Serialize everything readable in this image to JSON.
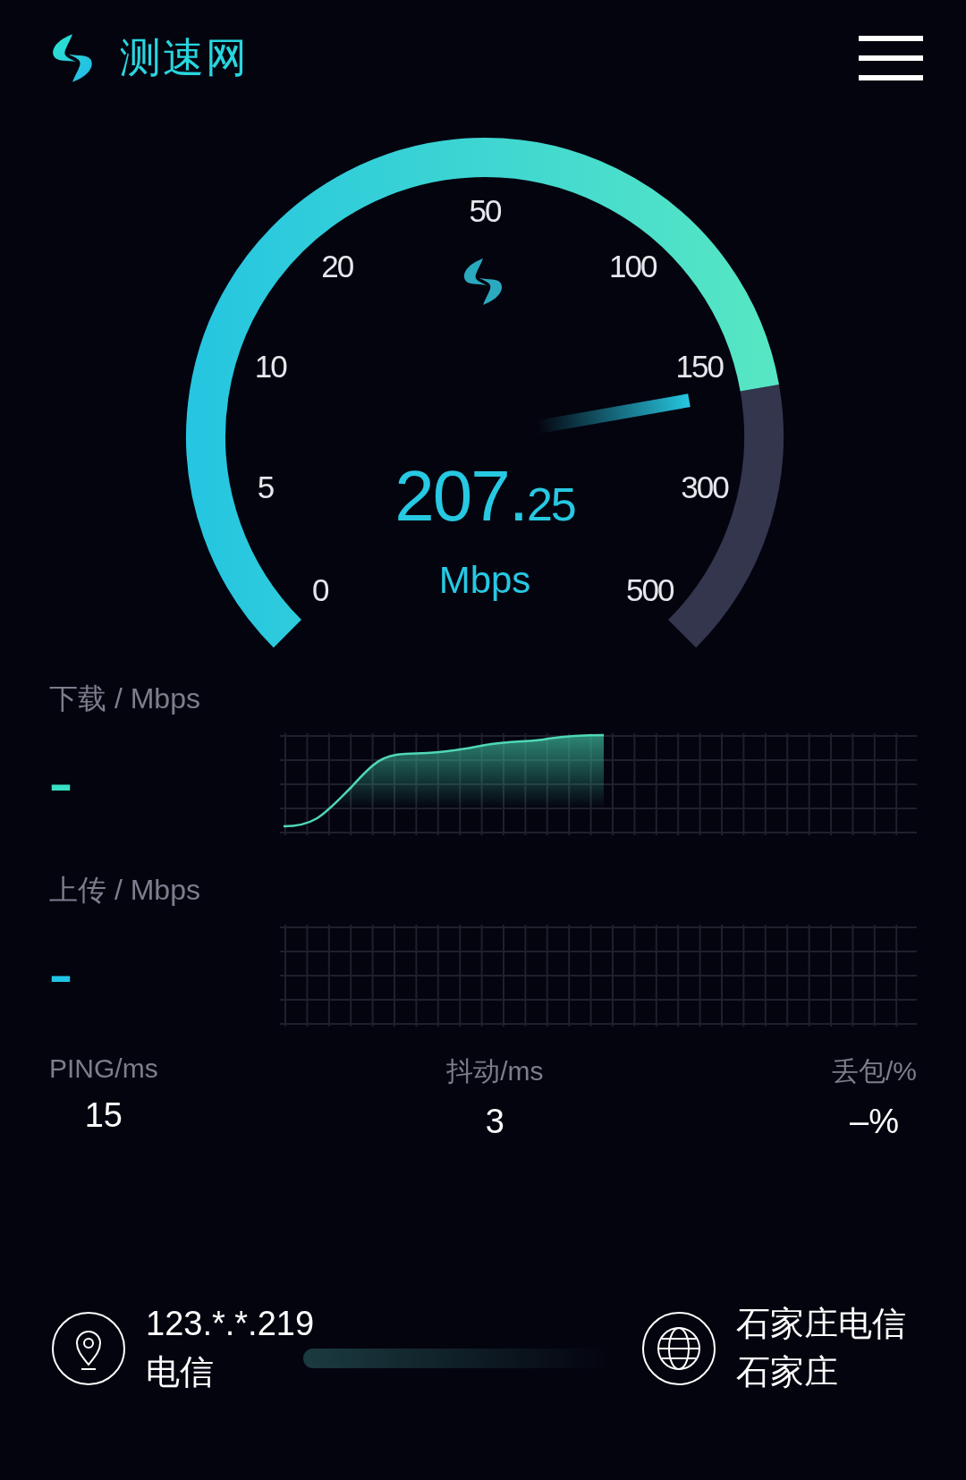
{
  "header": {
    "brand": "测速网"
  },
  "gauge": {
    "ticks": [
      "0",
      "5",
      "10",
      "20",
      "50",
      "100",
      "150",
      "300",
      "500"
    ],
    "speed_whole": "207.",
    "speed_fraction": "25",
    "unit": "Mbps"
  },
  "metrics": [
    {
      "kind": "download",
      "label": "下载 / Mbps",
      "value": "–"
    },
    {
      "kind": "upload",
      "label": "上传 / Mbps",
      "value": "–"
    }
  ],
  "stats": [
    {
      "label": "PING/ms",
      "value": "15"
    },
    {
      "label": "抖动/ms",
      "value": "3"
    },
    {
      "label": "丢包/%",
      "value": "–%"
    }
  ],
  "client": {
    "ip": "123.*.*.219",
    "isp": "电信"
  },
  "server": {
    "name": "石家庄电信",
    "city": "石家庄"
  }
}
